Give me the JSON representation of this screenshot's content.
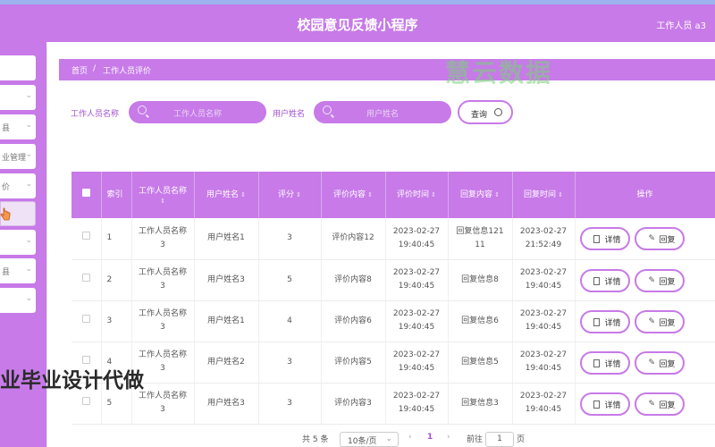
{
  "header": {
    "title": "校园意见反馈小程序",
    "user": "工作人员 a3"
  },
  "sidebar": {
    "items": [
      {
        "label": "",
        "chev": ""
      },
      {
        "label": "",
        "chev": "⌄"
      },
      {
        "label": "县",
        "chev": "⌄"
      },
      {
        "label": "业管理",
        "chev": "⌄"
      },
      {
        "label": "价",
        "chev": "⌄"
      },
      {
        "label": "",
        "chev": ""
      },
      {
        "label": "",
        "chev": "⌄"
      },
      {
        "label": "县",
        "chev": "⌄"
      },
      {
        "label": "",
        "chev": "⌄"
      }
    ]
  },
  "breadcrumb": {
    "home": "首页",
    "sep": "/",
    "current": "工作人员评价"
  },
  "watermark": "慧云数据",
  "search": {
    "staff_label": "工作人员名称",
    "staff_placeholder": "工作人员名称",
    "user_label": "用户姓名",
    "user_placeholder": "用户姓名",
    "query_label": "查询"
  },
  "table": {
    "columns": {
      "index": "索引",
      "staff_name": "工作人员名称",
      "user_name": "用户姓名",
      "score": "评分",
      "content": "评价内容",
      "time": "评价时间",
      "reply": "回复内容",
      "reply_time": "回复时间",
      "ops": "操作"
    },
    "rows": [
      {
        "index": "1",
        "staff_a": "工作人员名称",
        "staff_b": "3",
        "user": "用户姓名1",
        "score": "3",
        "content": "评价内容12",
        "date": "2023-02-27",
        "time": "19:40:45",
        "reply_a": "回复信息121",
        "reply_b": "11",
        "rdate": "2023-02-27",
        "rtime": "21:52:49"
      },
      {
        "index": "2",
        "staff_a": "工作人员名称",
        "staff_b": "3",
        "user": "用户姓名3",
        "score": "5",
        "content": "评价内容8",
        "date": "2023-02-27",
        "time": "19:40:45",
        "reply_a": "回复信息8",
        "reply_b": "",
        "rdate": "2023-02-27",
        "rtime": "19:40:45"
      },
      {
        "index": "3",
        "staff_a": "工作人员名称",
        "staff_b": "3",
        "user": "用户姓名1",
        "score": "4",
        "content": "评价内容6",
        "date": "2023-02-27",
        "time": "19:40:45",
        "reply_a": "回复信息6",
        "reply_b": "",
        "rdate": "2023-02-27",
        "rtime": "19:40:45"
      },
      {
        "index": "4",
        "staff_a": "工作人员名称",
        "staff_b": "3",
        "user": "用户姓名2",
        "score": "3",
        "content": "评价内容5",
        "date": "2023-02-27",
        "time": "19:40:45",
        "reply_a": "回复信息5",
        "reply_b": "",
        "rdate": "2023-02-27",
        "rtime": "19:40:45"
      },
      {
        "index": "5",
        "staff_a": "工作人员名称",
        "staff_b": "3",
        "user": "用户姓名3",
        "score": "3",
        "content": "评价内容3",
        "date": "2023-02-27",
        "time": "19:40:45",
        "reply_a": "回复信息3",
        "reply_b": "",
        "rdate": "2023-02-27",
        "rtime": "19:40:45"
      }
    ],
    "detail_label": "详情",
    "reply_label": "回复"
  },
  "overlay_text": "业毕业设计代做",
  "pagination": {
    "total": "共 5 条",
    "page_size": "10条/页",
    "prev": "‹",
    "current": "1",
    "next": "›",
    "goto": "前往",
    "goto_value": "1",
    "page_unit": "页"
  }
}
